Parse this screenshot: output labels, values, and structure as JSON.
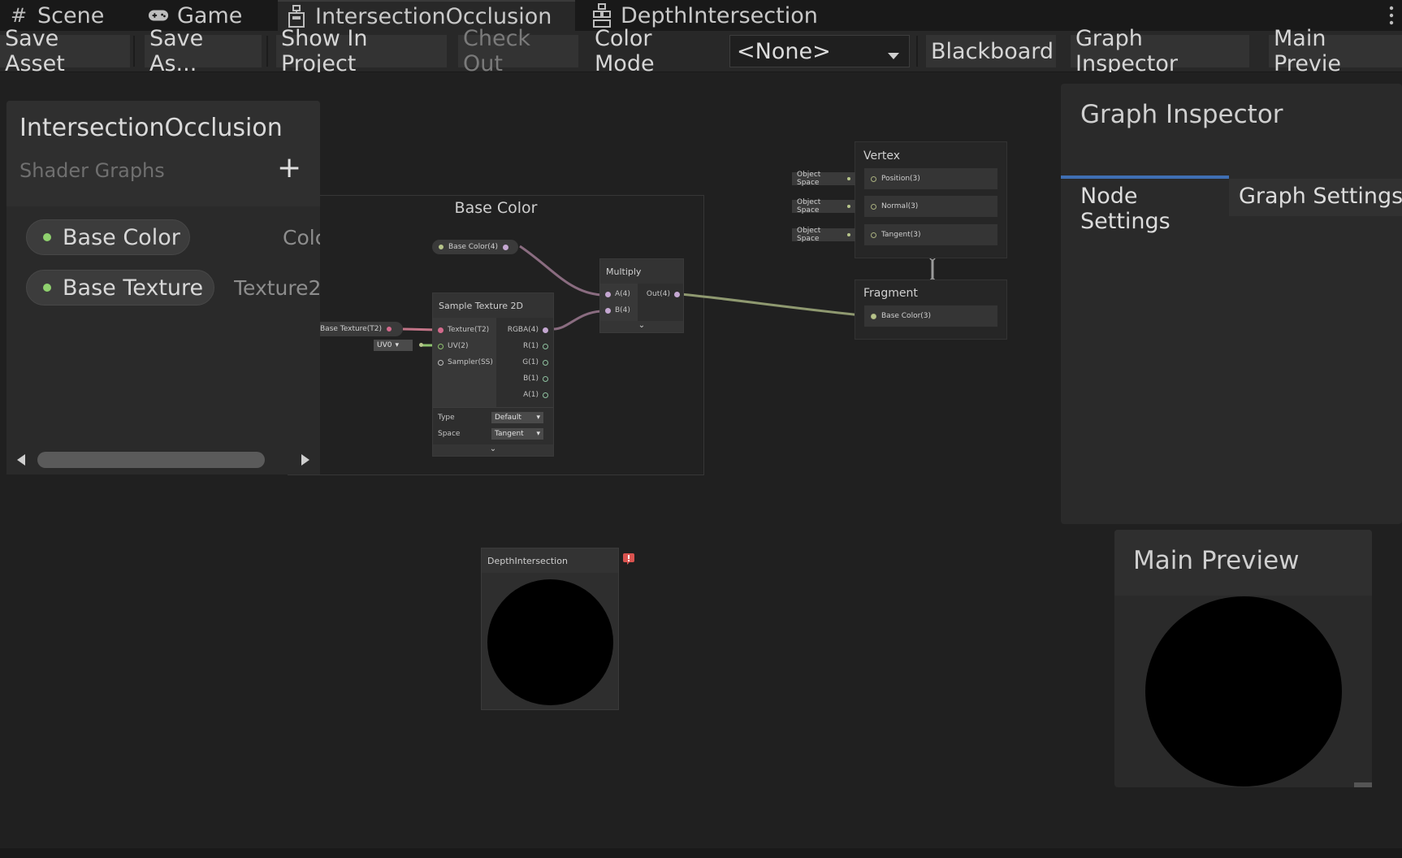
{
  "tabs": [
    {
      "label": "Scene",
      "icon": "grid-icon"
    },
    {
      "label": "Game",
      "icon": "gamepad-icon"
    },
    {
      "label": "IntersectionOcclusion",
      "icon": "shader-graph-icon",
      "active": true
    },
    {
      "label": "DepthIntersection",
      "icon": "sub-graph-icon"
    }
  ],
  "toolbar": {
    "save_asset": "Save Asset",
    "save_as": "Save As...",
    "show_in_project": "Show In Project",
    "check_out": "Check Out",
    "color_mode_label": "Color Mode",
    "color_mode_value": "<None>",
    "blackboard": "Blackboard",
    "graph_inspector": "Graph Inspector",
    "main_preview": "Main Previe"
  },
  "blackboard": {
    "title": "IntersectionOcclusion",
    "subtitle": "Shader Graphs",
    "add": "+",
    "properties": [
      {
        "name": "Base Color",
        "type": "Colc"
      },
      {
        "name": "Base Texture",
        "type": "Texture2"
      }
    ]
  },
  "group": {
    "title": "Base Color"
  },
  "nodes": {
    "base_color_prop": {
      "label": "Base Color(4)"
    },
    "base_texture_prop": {
      "label": "Base Texture(T2)"
    },
    "uv_dropdown": "UV0",
    "sample_texture": {
      "title": "Sample Texture 2D",
      "inputs": [
        "Texture(T2)",
        "UV(2)",
        "Sampler(SS)"
      ],
      "outputs": [
        "RGBA(4)",
        "R(1)",
        "G(1)",
        "B(1)",
        "A(1)"
      ],
      "type_label": "Type",
      "type_value": "Default",
      "space_label": "Space",
      "space_value": "Tangent"
    },
    "multiply": {
      "title": "Multiply",
      "inputs": [
        "A(4)",
        "B(4)"
      ],
      "output": "Out(4)"
    },
    "depth_intersection": {
      "title": "DepthIntersection"
    }
  },
  "master": {
    "vertex": {
      "title": "Vertex",
      "blocks": [
        "Position(3)",
        "Normal(3)",
        "Tangent(3)"
      ],
      "space": "Object Space"
    },
    "fragment": {
      "title": "Fragment",
      "blocks": [
        "Base Color(3)"
      ]
    }
  },
  "inspector": {
    "title": "Graph Inspector",
    "tabs": [
      "Node Settings",
      "Graph Settings"
    ]
  },
  "preview": {
    "title": "Main Preview"
  },
  "colors": {
    "accent": "#3f6fb3",
    "error": "#d9534f",
    "port_green": "#8fd16e",
    "wire_purple": "#8a6c80",
    "wire_olive": "#8f9970"
  }
}
